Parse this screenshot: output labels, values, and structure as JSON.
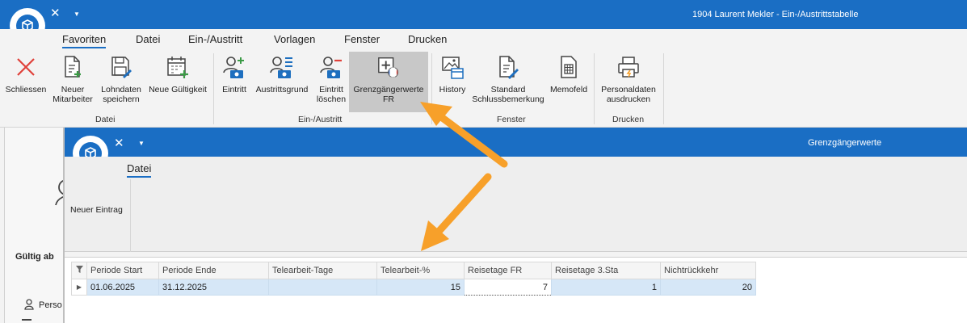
{
  "main_window": {
    "title": "1904 Laurent Mekler - Ein-/Austrittstabelle",
    "menu": [
      "Favoriten",
      "Datei",
      "Ein-/Austritt",
      "Vorlagen",
      "Fenster",
      "Drucken"
    ],
    "active_menu": "Favoriten",
    "ribbon": {
      "datei": {
        "label": "Datei",
        "buttons": {
          "schliessen": "Schliessen",
          "neuer_mitarbeiter": "Neuer\nMitarbeiter",
          "lohndaten_speichern": "Lohndaten\nspeichern",
          "neue_gueltigkeit": "Neue Gültigkeit"
        }
      },
      "ein_austritt": {
        "label": "Ein-/Austritt",
        "buttons": {
          "eintritt": "Eintritt",
          "austrittsgrund": "Austrittsgrund",
          "eintritt_loeschen": "Eintritt\nlöschen",
          "grenzgaengerwerte_fr": "Grenzgängerwerte\nFR"
        }
      },
      "fenster": {
        "label": "Fenster",
        "buttons": {
          "history": "History",
          "standard_schlussbemerkung": "Standard\nSchlussbemerkung",
          "memofeld": "Memofeld"
        }
      },
      "drucken": {
        "label": "Drucken",
        "buttons": {
          "personaldaten_ausdrucken": "Personaldaten\nausdrucken"
        }
      }
    },
    "left_panel": {
      "gueltig_ab": "Gültig ab",
      "person_label": "Perso"
    }
  },
  "child_window": {
    "title": "Grenzgängerwerte",
    "menu": [
      "Datei"
    ],
    "ribbon": {
      "neuer_eintrag": "Neuer Eintrag"
    },
    "grid": {
      "columns": [
        "Periode Start",
        "Periode Ende",
        "Telearbeit-Tage",
        "Telearbeit-%",
        "Reisetage FR",
        "Reisetage 3.Sta",
        "Nichtrückkehr"
      ],
      "rows": [
        [
          "01.06.2025",
          "31.12.2025",
          "",
          "15",
          "7",
          "1",
          "20"
        ]
      ]
    }
  },
  "colors": {
    "title_bar": "#1a6ec4",
    "highlight_button": "#c8c8c8",
    "selected_row": "#d6e7f7",
    "arrow": "#f7a02a",
    "close_red": "#e0413a",
    "icon_green": "#3a9a45",
    "icon_blue": "#1e6fbf"
  },
  "icons": {
    "schliessen": "close-x-icon",
    "neuer_mitarbeiter": "document-plus-icon",
    "lohndaten_speichern": "save-edit-icon",
    "neue_gueltigkeit": "calendar-plus-icon",
    "eintritt": "person-add-icon",
    "austrittsgrund": "person-list-icon",
    "eintritt_loeschen": "person-remove-icon",
    "grenzgaengerwerte_fr": "medical-flag-fr-icon",
    "history": "image-calendar-icon",
    "standard_schlussbemerkung": "document-edit-icon",
    "memofeld": "calculator-doc-icon",
    "personaldaten_ausdrucken": "printer-icon"
  }
}
